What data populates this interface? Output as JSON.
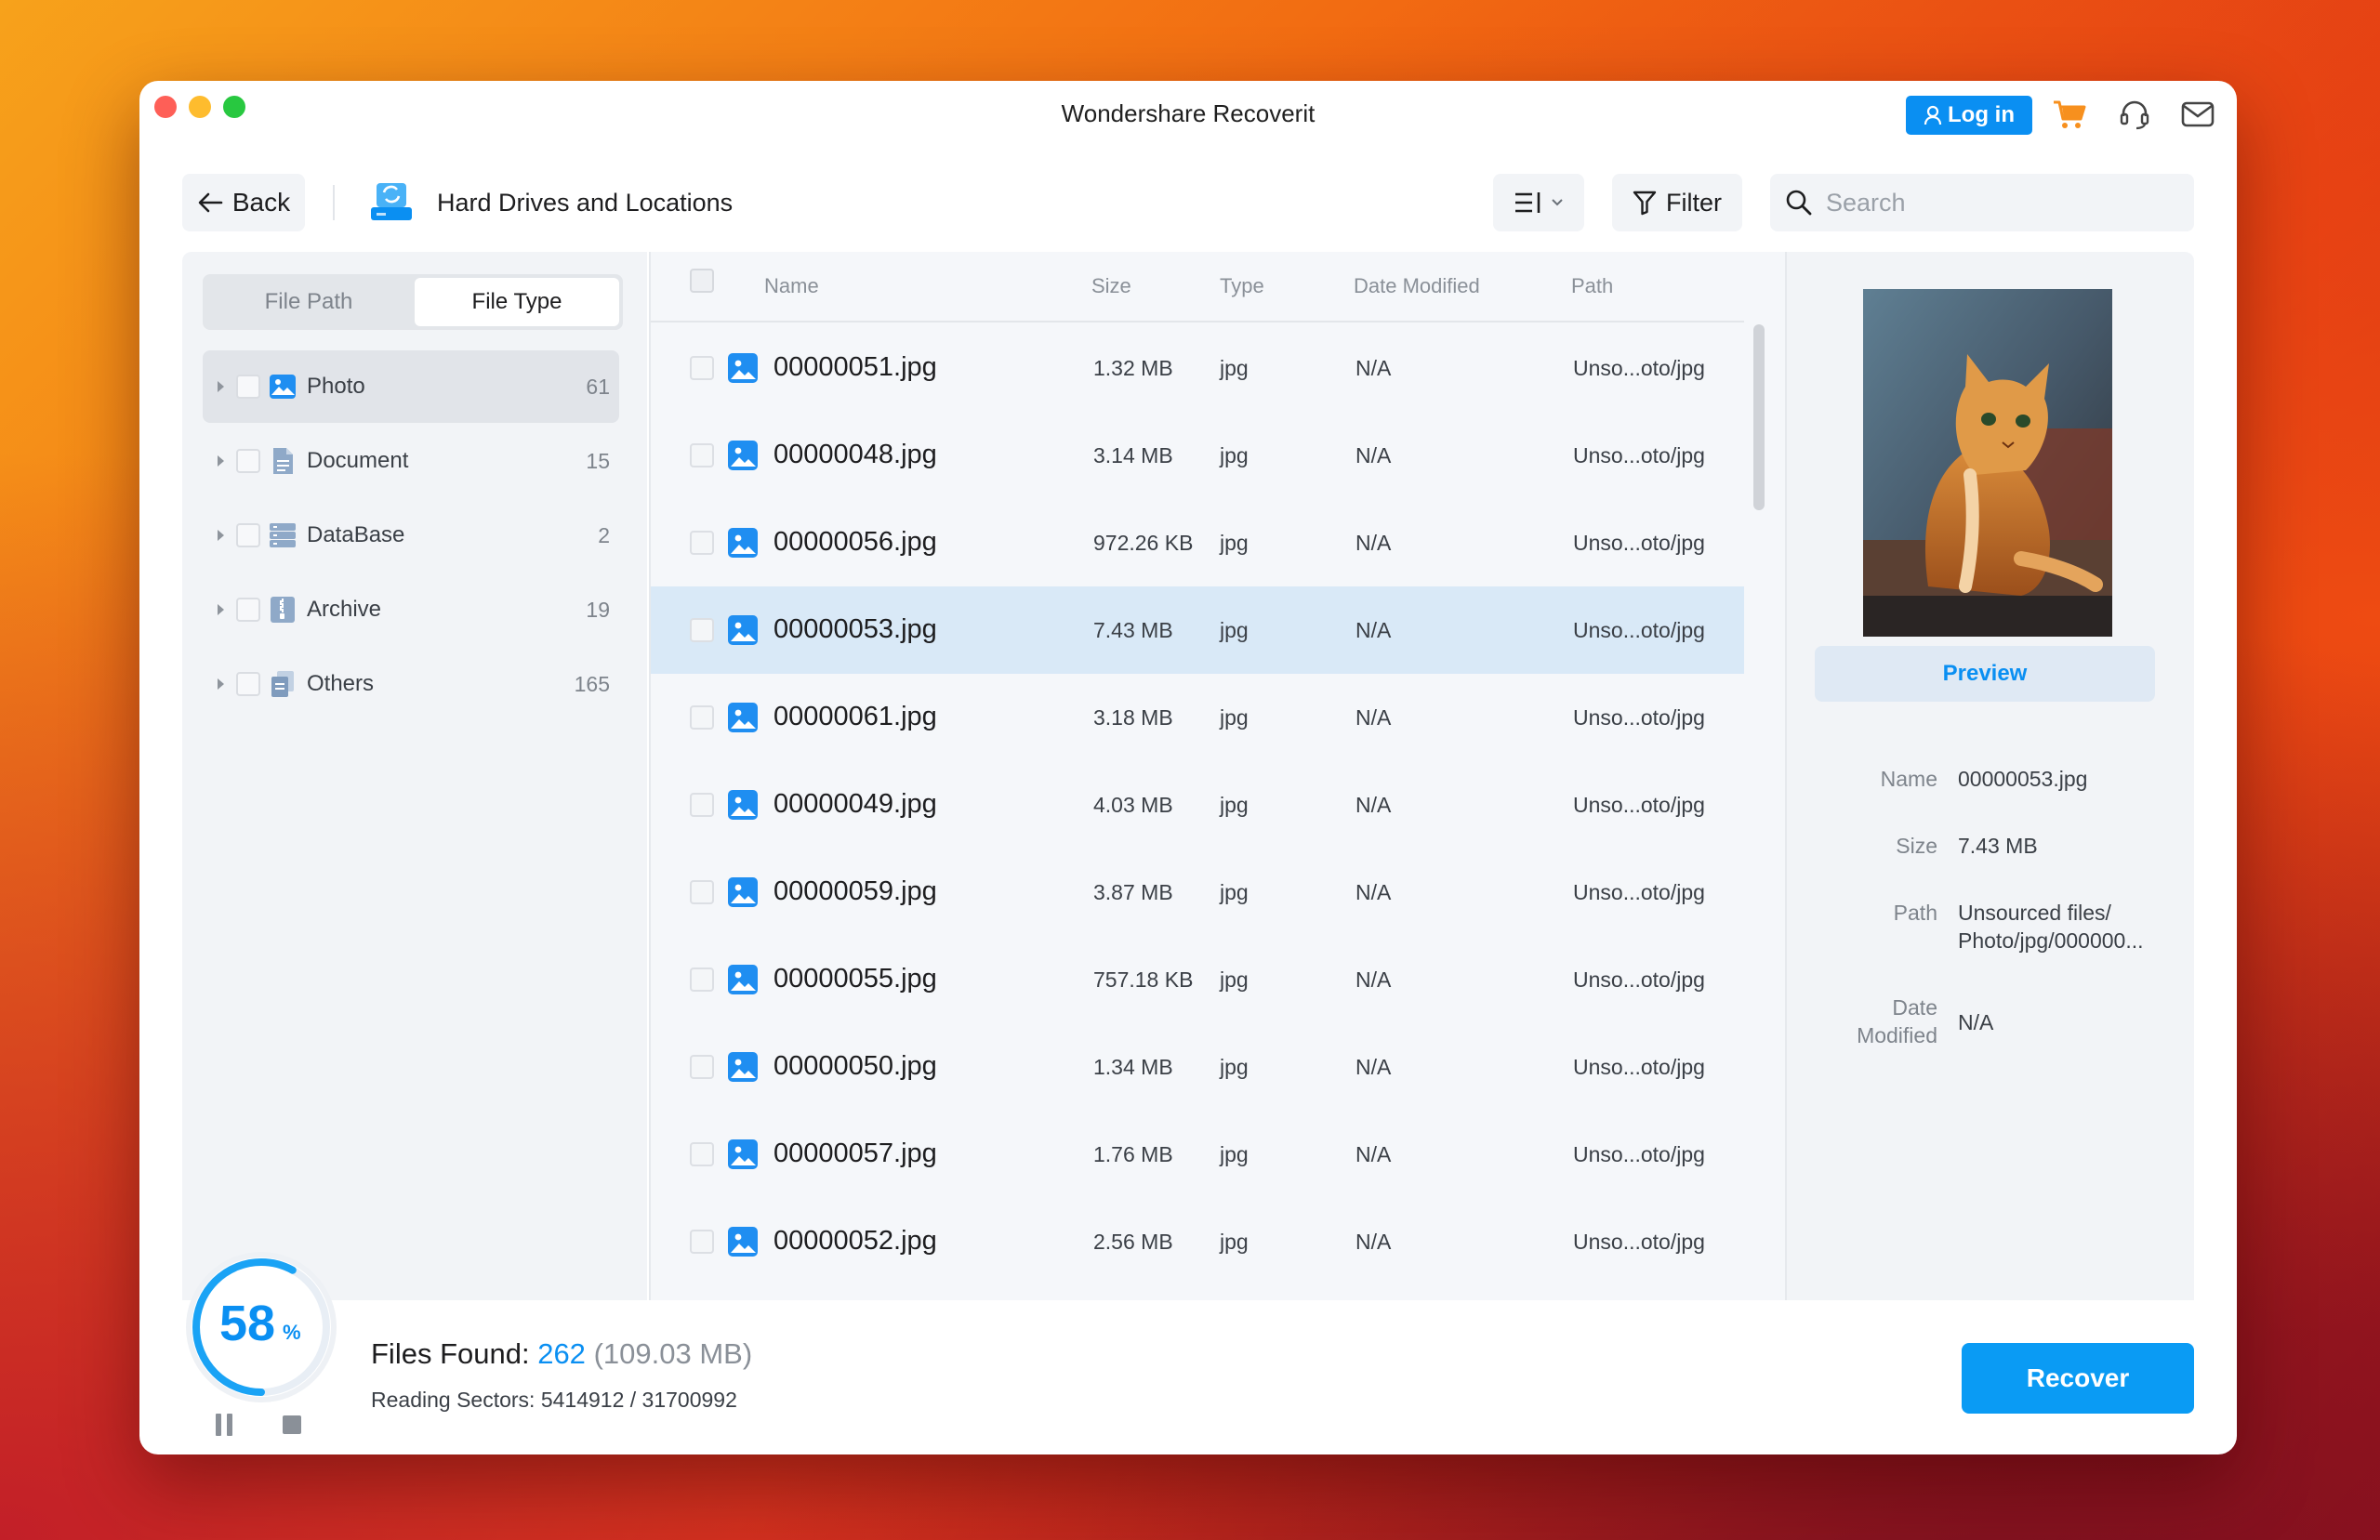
{
  "window": {
    "title": "Wondershare Recoverit"
  },
  "titlebar": {
    "login_label": "Log in",
    "icons": [
      "user-icon",
      "cart-icon",
      "headset-icon",
      "mail-icon"
    ]
  },
  "toolbar": {
    "back_label": "Back",
    "location_title": "Hard Drives and Locations",
    "filter_label": "Filter",
    "search_placeholder": "Search"
  },
  "sidebar": {
    "tabs": [
      {
        "label": "File Path",
        "active": false
      },
      {
        "label": "File Type",
        "active": true
      }
    ],
    "items": [
      {
        "label": "Photo",
        "count": "61",
        "icon": "photo-icon",
        "selected": true
      },
      {
        "label": "Document",
        "count": "15",
        "icon": "document-icon",
        "selected": false
      },
      {
        "label": "DataBase",
        "count": "2",
        "icon": "database-icon",
        "selected": false
      },
      {
        "label": "Archive",
        "count": "19",
        "icon": "archive-icon",
        "selected": false
      },
      {
        "label": "Others",
        "count": "165",
        "icon": "others-icon",
        "selected": false
      }
    ]
  },
  "table": {
    "columns": [
      "Name",
      "Size",
      "Type",
      "Date Modified",
      "Path"
    ],
    "rows": [
      {
        "name": "00000051.jpg",
        "size": "1.32 MB",
        "type": "jpg",
        "date": "N/A",
        "path": "Unso...oto/jpg",
        "selected": false
      },
      {
        "name": "00000048.jpg",
        "size": "3.14 MB",
        "type": "jpg",
        "date": "N/A",
        "path": "Unso...oto/jpg",
        "selected": false
      },
      {
        "name": "00000056.jpg",
        "size": "972.26 KB",
        "type": "jpg",
        "date": "N/A",
        "path": "Unso...oto/jpg",
        "selected": false
      },
      {
        "name": "00000053.jpg",
        "size": "7.43 MB",
        "type": "jpg",
        "date": "N/A",
        "path": "Unso...oto/jpg",
        "selected": true
      },
      {
        "name": "00000061.jpg",
        "size": "3.18 MB",
        "type": "jpg",
        "date": "N/A",
        "path": "Unso...oto/jpg",
        "selected": false
      },
      {
        "name": "00000049.jpg",
        "size": "4.03 MB",
        "type": "jpg",
        "date": "N/A",
        "path": "Unso...oto/jpg",
        "selected": false
      },
      {
        "name": "00000059.jpg",
        "size": "3.87 MB",
        "type": "jpg",
        "date": "N/A",
        "path": "Unso...oto/jpg",
        "selected": false
      },
      {
        "name": "00000055.jpg",
        "size": "757.18 KB",
        "type": "jpg",
        "date": "N/A",
        "path": "Unso...oto/jpg",
        "selected": false
      },
      {
        "name": "00000050.jpg",
        "size": "1.34 MB",
        "type": "jpg",
        "date": "N/A",
        "path": "Unso...oto/jpg",
        "selected": false
      },
      {
        "name": "00000057.jpg",
        "size": "1.76 MB",
        "type": "jpg",
        "date": "N/A",
        "path": "Unso...oto/jpg",
        "selected": false
      },
      {
        "name": "00000052.jpg",
        "size": "2.56 MB",
        "type": "jpg",
        "date": "N/A",
        "path": "Unso...oto/jpg",
        "selected": false
      }
    ]
  },
  "preview": {
    "button_label": "Preview",
    "name_label": "Name",
    "name_value": "00000053.jpg",
    "size_label": "Size",
    "size_value": "7.43 MB",
    "path_label": "Path",
    "path_value_1": "Unsourced files/",
    "path_value_2": "Photo/jpg/000000...",
    "date_label_1": "Date",
    "date_label_2": "Modified",
    "date_value": "N/A"
  },
  "status": {
    "progress_percent": "58",
    "percent_sign": "%",
    "progress_fraction": 0.58,
    "files_found_label": "Files Found:",
    "files_found_count": "262",
    "files_found_size": "(109.03 MB)",
    "reading_sectors": "Reading Sectors: 5414912 / 31700992",
    "recover_label": "Recover"
  },
  "colors": {
    "accent": "#0a8ff2",
    "selected_row": "#d9e9f7",
    "panel": "#f2f4f7"
  }
}
